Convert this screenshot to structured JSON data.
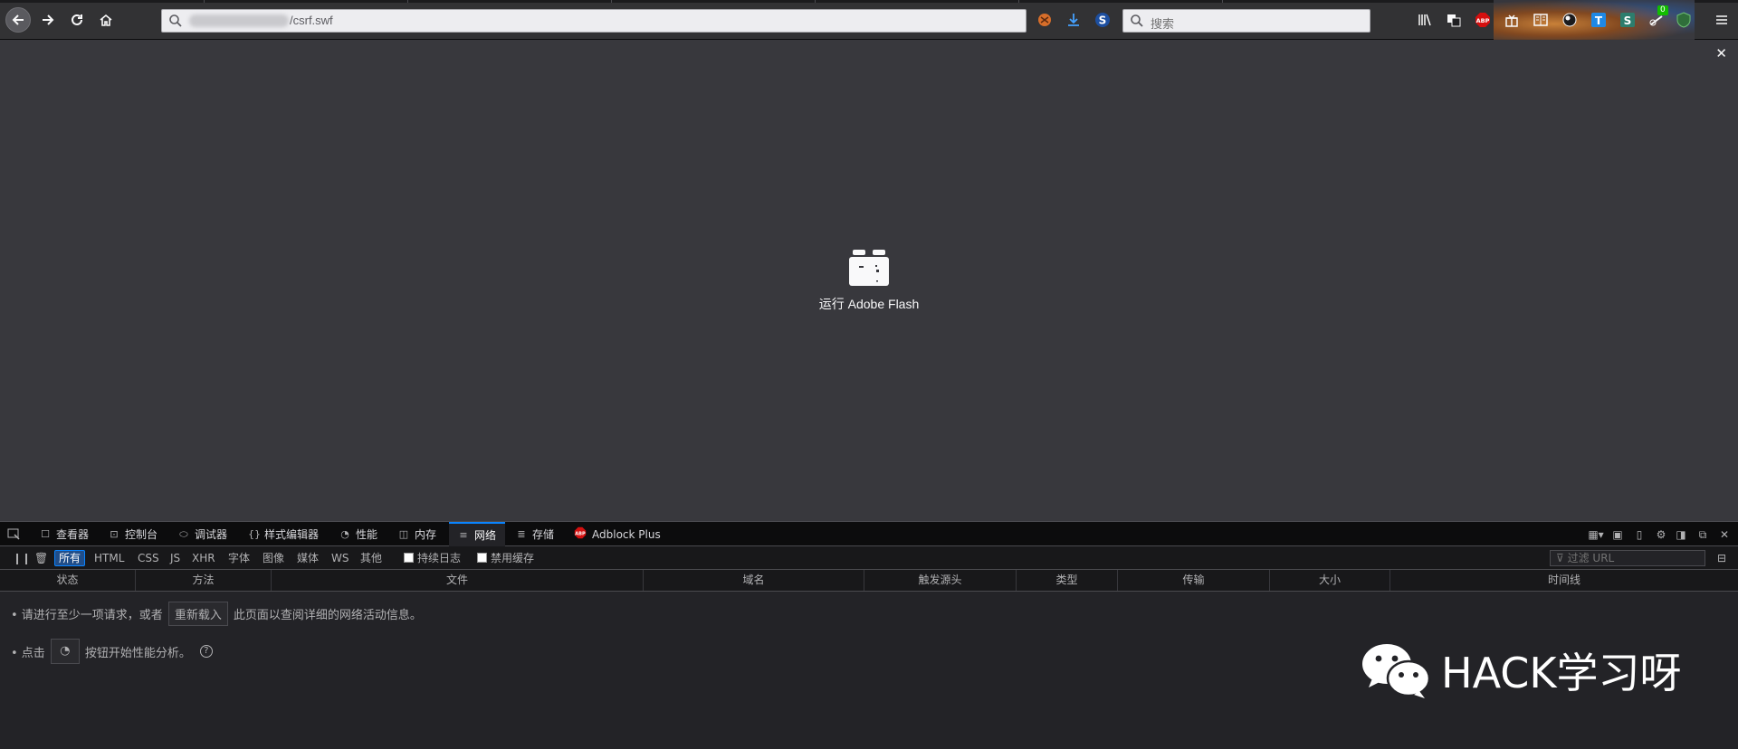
{
  "browser": {
    "url_suffix": "/csrf.swf",
    "search_placeholder": "搜索",
    "extension_badge": "0"
  },
  "content": {
    "plugin_prompt": "运行 Adobe Flash"
  },
  "devtools": {
    "tabs": [
      "查看器",
      "控制台",
      "调试器",
      "样式编辑器",
      "性能",
      "内存",
      "网络",
      "存储",
      "Adblock Plus"
    ],
    "active_tab": "网络",
    "filters": [
      "所有",
      "HTML",
      "CSS",
      "JS",
      "XHR",
      "字体",
      "图像",
      "媒体",
      "WS",
      "其他"
    ],
    "persist_log_label": "持续日志",
    "disable_cache_label": "禁用缓存",
    "filter_url_placeholder": "过滤 URL",
    "columns": [
      "状态",
      "方法",
      "文件",
      "域名",
      "触发源头",
      "类型",
      "传输",
      "大小",
      "时间线"
    ],
    "empty_msg_1a": "• 请进行至少一项请求，或者",
    "empty_reload": "重新载入",
    "empty_msg_1b": "此页面以查阅详细的网络活动信息。",
    "empty_msg_2a": "• 点击",
    "empty_msg_2b": "按钮开始性能分析。",
    "help_glyph": "?"
  },
  "watermark": {
    "text": "HACK学习呀"
  }
}
